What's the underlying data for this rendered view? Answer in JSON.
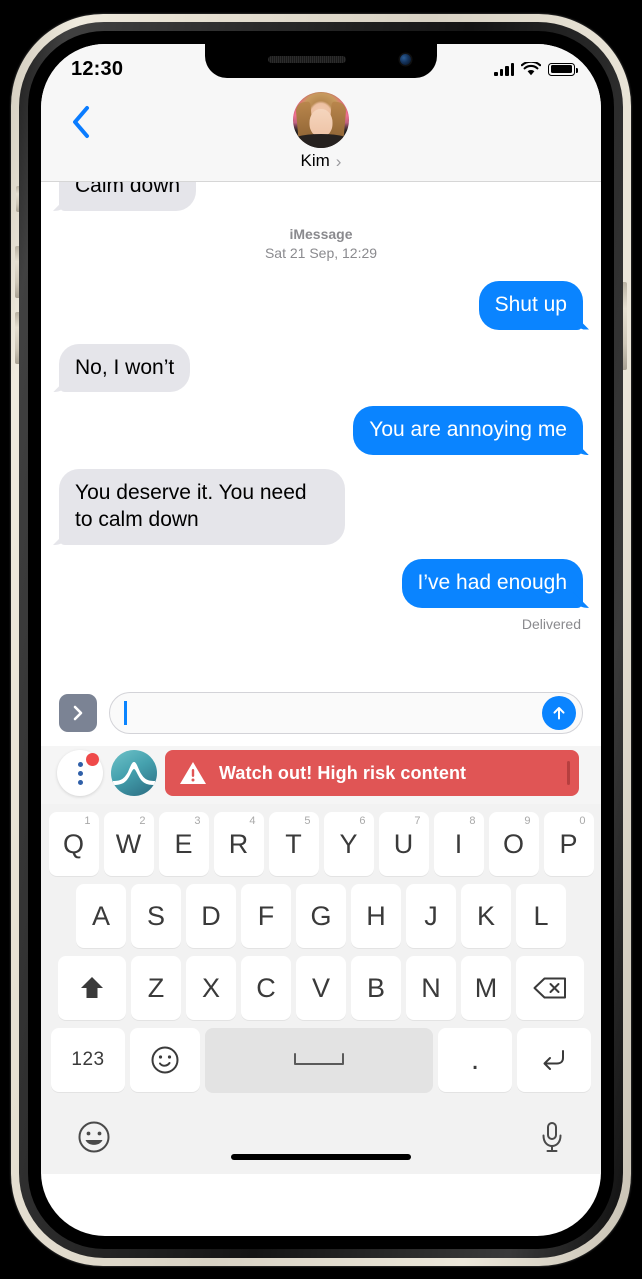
{
  "device": {
    "frame_color": "#e7e1d3",
    "bezel_color": "#000000"
  },
  "status_bar": {
    "time": "12:30",
    "signal_icon": "cellular-bars-icon",
    "wifi_icon": "wifi-icon",
    "battery_icon": "battery-full-icon"
  },
  "chat_header": {
    "back_icon": "chevron-left-icon",
    "contact_name": "Kim",
    "contact_chevron": "chevron-right-icon",
    "avatar_alt": "avatar"
  },
  "thread": {
    "messages": [
      {
        "id": "m1",
        "side": "in",
        "text": "Calm down",
        "clipped": true
      },
      {
        "id": "m2",
        "side": "out",
        "text": "Shut up"
      },
      {
        "id": "m3",
        "side": "in",
        "text": "No, I won’t"
      },
      {
        "id": "m4",
        "side": "out",
        "text": "You are annoying me"
      },
      {
        "id": "m5",
        "side": "in",
        "text": "You deserve it. You need to calm down"
      },
      {
        "id": "m6",
        "side": "out",
        "text": "I’ve had enough"
      }
    ],
    "separator": {
      "service": "iMessage",
      "timestamp": "Sat 21 Sep, 12:29"
    },
    "delivery_status": "Delivered",
    "bubble_out_color": "#0a84ff",
    "bubble_in_color": "#e5e5ea"
  },
  "input_bar": {
    "expand_icon": "chevron-right-icon",
    "field_value": "",
    "field_placeholder": "",
    "send_icon": "arrow-up-icon"
  },
  "overlay": {
    "menu_icon": "three-dots-vertical-icon",
    "notification_badge": "",
    "app_icon": "wave-peak-app-icon",
    "warning": {
      "icon": "warning-triangle-icon",
      "text": "Watch out! High risk content",
      "color": "#e05555"
    }
  },
  "keyboard": {
    "row1": [
      {
        "letter": "Q",
        "num": "1"
      },
      {
        "letter": "W",
        "num": "2"
      },
      {
        "letter": "E",
        "num": "3"
      },
      {
        "letter": "R",
        "num": "4"
      },
      {
        "letter": "T",
        "num": "5"
      },
      {
        "letter": "Y",
        "num": "6"
      },
      {
        "letter": "U",
        "num": "7"
      },
      {
        "letter": "I",
        "num": "8"
      },
      {
        "letter": "O",
        "num": "9"
      },
      {
        "letter": "P",
        "num": "0"
      }
    ],
    "row2": [
      {
        "letter": "A"
      },
      {
        "letter": "S"
      },
      {
        "letter": "D"
      },
      {
        "letter": "F"
      },
      {
        "letter": "G"
      },
      {
        "letter": "H"
      },
      {
        "letter": "J"
      },
      {
        "letter": "K"
      },
      {
        "letter": "L"
      }
    ],
    "row3": [
      {
        "letter": "Z"
      },
      {
        "letter": "X"
      },
      {
        "letter": "C"
      },
      {
        "letter": "V"
      },
      {
        "letter": "B"
      },
      {
        "letter": "N"
      },
      {
        "letter": "M"
      }
    ],
    "shift_icon": "shift-up-icon",
    "backspace_icon": "backspace-icon",
    "numbers_key": "123",
    "emoji_key_icon": "emoji-face-icon",
    "space_key_icon": "space-bar-icon",
    "period_key": ".",
    "enter_icon": "enter-return-icon",
    "bottom_emoji_icon": "smiley-face-icon",
    "bottom_mic_icon": "microphone-icon"
  }
}
